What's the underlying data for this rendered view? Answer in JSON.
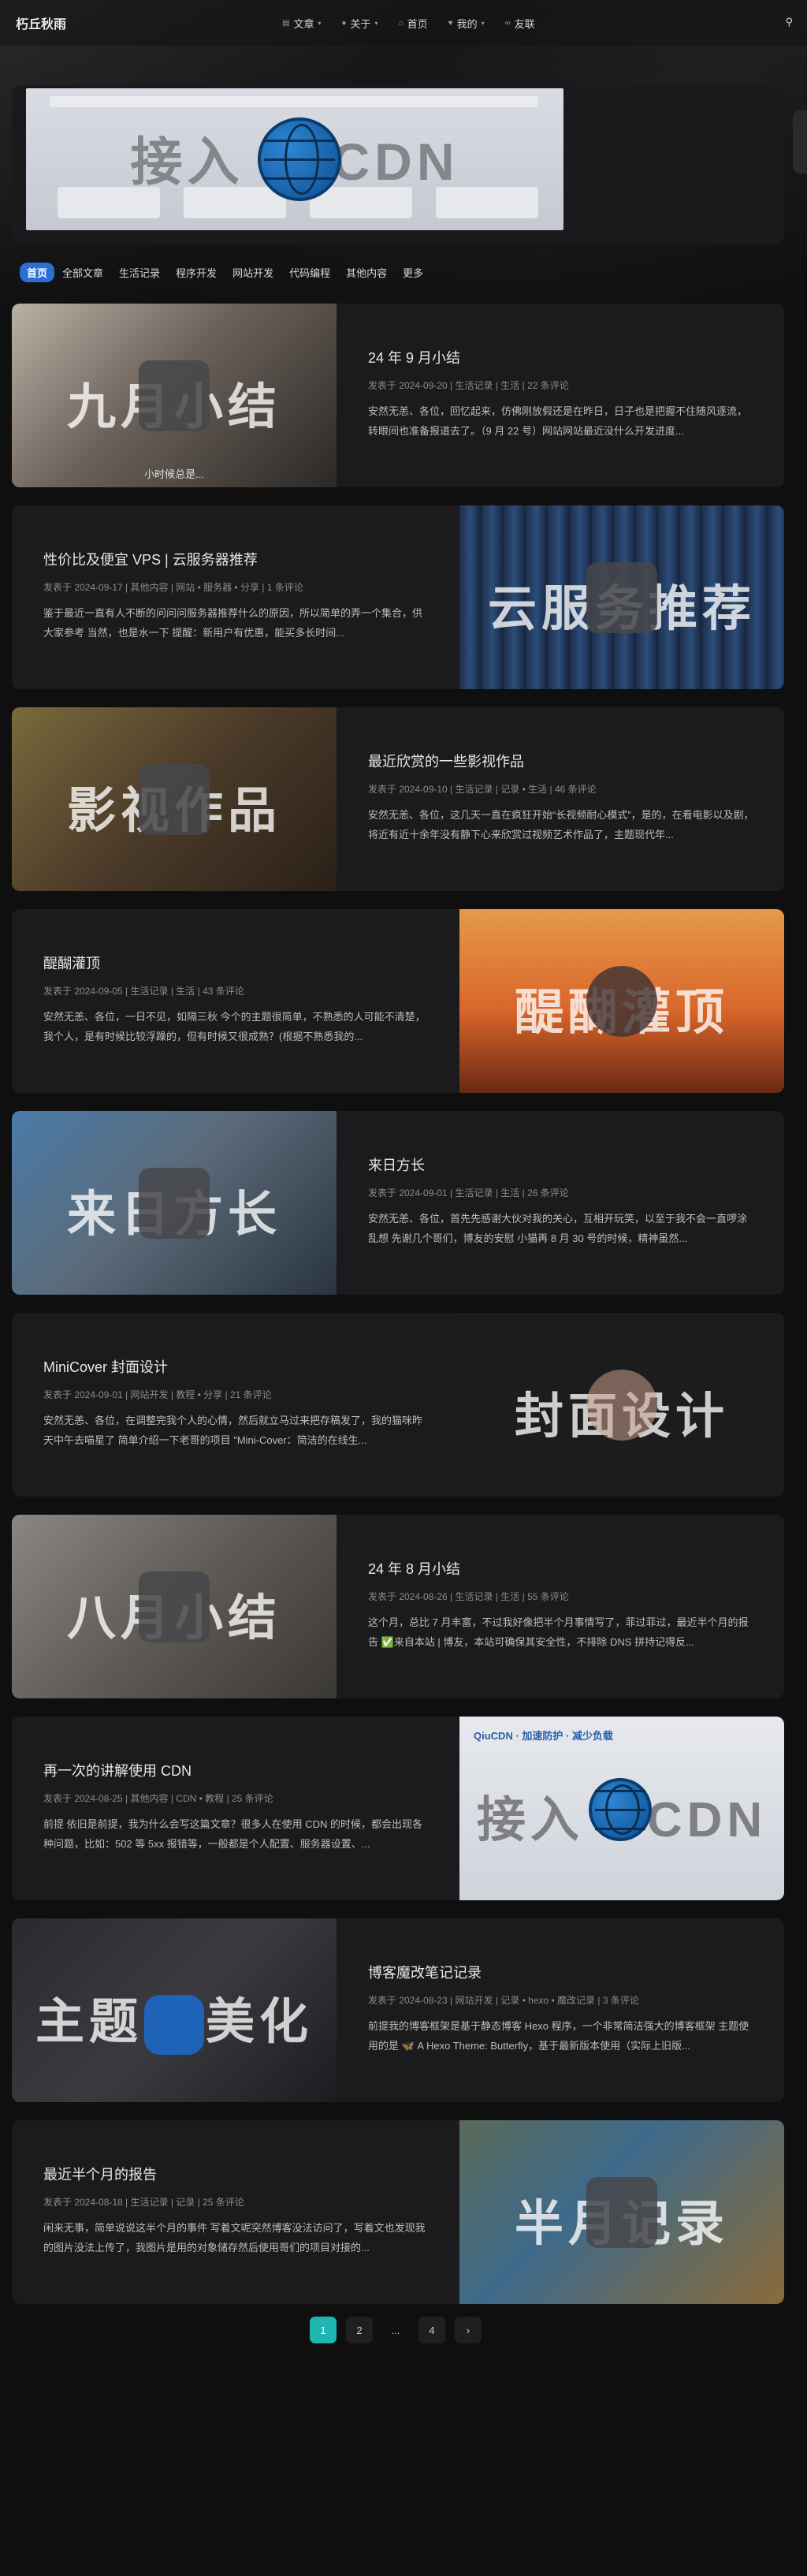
{
  "site": {
    "brand": "朽丘秋雨"
  },
  "nav": {
    "items": [
      {
        "label": "文章",
        "icon": "book-icon",
        "dropdown": true
      },
      {
        "label": "关于",
        "icon": "user-icon",
        "dropdown": true
      },
      {
        "label": "首页",
        "icon": "home-icon",
        "dropdown": false
      },
      {
        "label": "我的",
        "icon": "heart-icon",
        "dropdown": true
      },
      {
        "label": "友联",
        "icon": "link-icon",
        "dropdown": false
      }
    ],
    "search_icon": "search-icon"
  },
  "banner": {
    "title": "接入CDN",
    "title_left": "接入",
    "title_right": "CDN"
  },
  "categories": [
    "首页",
    "全部文章",
    "生活记录",
    "程序开发",
    "网站开发",
    "代码编程",
    "其他内容",
    "更多"
  ],
  "posts": [
    {
      "title": "24 年 9 月小结",
      "cover_text": "九月小结",
      "cover_caption": "小时候总是...",
      "meta": "发表于 2024-09-20 | 生活记录 | 生活 | 22 条评论",
      "excerpt": "安然无恙、各位，回忆起来，仿佛刚放假还是在昨日，日子也是把握不住随风逐流，转眼间也准备报道去了。（9 月 22 号）网站网站最近没什么开发进度..."
    },
    {
      "title": "性价比及便宜 VPS | 云服务器推荐",
      "cover_text": "云服务推荐",
      "meta": "发表于 2024-09-17 | 其他内容 | 网站 • 服务器 • 分享 | 1 条评论",
      "excerpt": "鉴于最近一直有人不断的问问问服务器推荐什么的原因，所以简单的弄一个集合，供大家参考 当然，也是水一下 提醒：新用户有优惠，能买多长时间..."
    },
    {
      "title": "最近欣赏的一些影视作品",
      "cover_text": "影视作品",
      "meta": "发表于 2024-09-10 | 生活记录 | 记录 • 生活 | 46 条评论",
      "excerpt": "安然无恙、各位，这几天一直在疯狂开始“长视频耐心模式”，是的，在看电影以及剧，将近有近十余年没有静下心来欣赏过视频艺术作品了，主题现代年..."
    },
    {
      "title": "醍醐灌顶",
      "cover_text": "醍醐灌顶",
      "meta": "发表于 2024-09-05 | 生活记录 | 生活 | 43 条评论",
      "excerpt": "安然无恙、各位，一日不见，如隔三秋 今个的主题很简单，不熟悉的人可能不清楚，我个人，是有时候比较浮躁的，但有时候又很成熟？(根据不熟悉我的..."
    },
    {
      "title": "来日方长",
      "cover_text": "来日方长",
      "meta": "发表于 2024-09-01 | 生活记录 | 生活 | 26 条评论",
      "excerpt": "安然无恙、各位，首先先感谢大伙对我的关心，互相开玩笑，以至于我不会一直啰涂乱想 先谢几个哥们，博友的安慰 小猫再 8 月 30 号的时候，精神虽然..."
    },
    {
      "title": "MiniCover 封面设计",
      "cover_text": "封面设计",
      "meta": "发表于 2024-09-01 | 网站开发 | 教程 • 分享 | 21 条评论",
      "excerpt": "安然无恙、各位，在调整完我个人的心情，然后就立马过来把存稿发了，我的猫咪昨天中午去喵星了 简单介绍一下老哥的项目 \"Mini-Cover：简洁的在线生..."
    },
    {
      "title": "24 年 8 月小结",
      "cover_text": "八月小结",
      "meta": "发表于 2024-08-26 | 生活记录 | 生活 | 55 条评论",
      "excerpt": "这个月，总比 7 月丰富，不过我好像把半个月事情写了，菲过菲过，最近半个月的报告 ✅来自本站 | 博友，本站可确保其安全性，不排除 DNS 拼持记得反..."
    },
    {
      "title": "再一次的讲解使用 CDN",
      "cover_text": "接入CDN",
      "cover_caption": "QiuCDN · 加速防护 · 减少负载",
      "meta": "发表于 2024-08-25 | 其他内容 | CDN • 教程 | 25 条评论",
      "excerpt": "前提 依旧是前提，我为什么会写这篇文章？很多人在使用 CDN 的时候，都会出现各种问题，比如：502 等 5xx 报错等，一般都是个人配置、服务器设置、..."
    },
    {
      "title": "博客魔改笔记记录",
      "cover_text": "主题美化",
      "meta": "发表于 2024-08-23 | 网站开发 | 记录 • hexo • 魔改记录 | 3 条评论",
      "excerpt": "前提我的博客框架是基于静态博客 Hexo 程序，一个非常简洁强大的博客框架 主题使用的是 🦋 A Hexo Theme: Butterfly，基于最新版本使用（实际上旧版..."
    },
    {
      "title": "最近半个月的报告",
      "cover_text": "半月记录",
      "meta": "发表于 2024-08-18 | 生活记录 | 记录 | 25 条评论",
      "excerpt": "闲来无事，简单说说这半个月的事件 写着文呢突然博客没法访问了，写着文也发现我的图片没法上传了，我图片是用的对象储存然后使用哥们的项目对接的..."
    }
  ],
  "pagination": {
    "pages": [
      "1",
      "2",
      "...",
      "4"
    ],
    "current": "1",
    "next_icon": "chevron-right-icon"
  }
}
